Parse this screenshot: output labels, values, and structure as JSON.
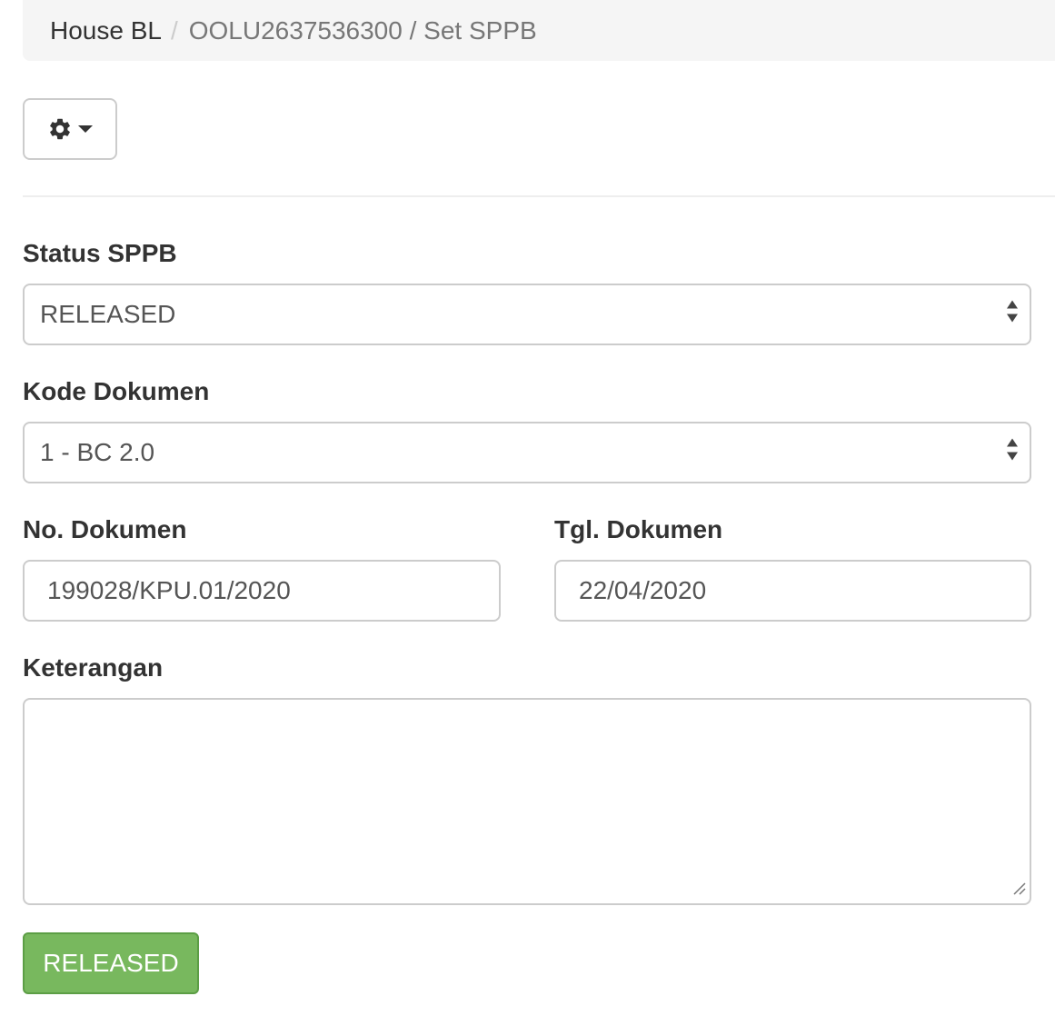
{
  "breadcrumb": {
    "parent": "House BL",
    "separator": "/",
    "current": "OOLU2637536300 / Set SPPB"
  },
  "toolbar": {
    "settings_icon": "gear-icon",
    "dropdown_icon": "caret-down-icon"
  },
  "form": {
    "status_sppb": {
      "label": "Status SPPB",
      "selected": "RELEASED"
    },
    "kode_dokumen": {
      "label": "Kode Dokumen",
      "selected": "1 - BC 2.0"
    },
    "no_dokumen": {
      "label": "No. Dokumen",
      "value": "199028/KPU.01/2020"
    },
    "tgl_dokumen": {
      "label": "Tgl. Dokumen",
      "value": "22/04/2020"
    },
    "keterangan": {
      "label": "Keterangan",
      "value": ""
    },
    "submit_label": "RELEASED"
  },
  "colors": {
    "submit_bg": "#78b85e",
    "breadcrumb_bg": "#f5f5f5"
  }
}
